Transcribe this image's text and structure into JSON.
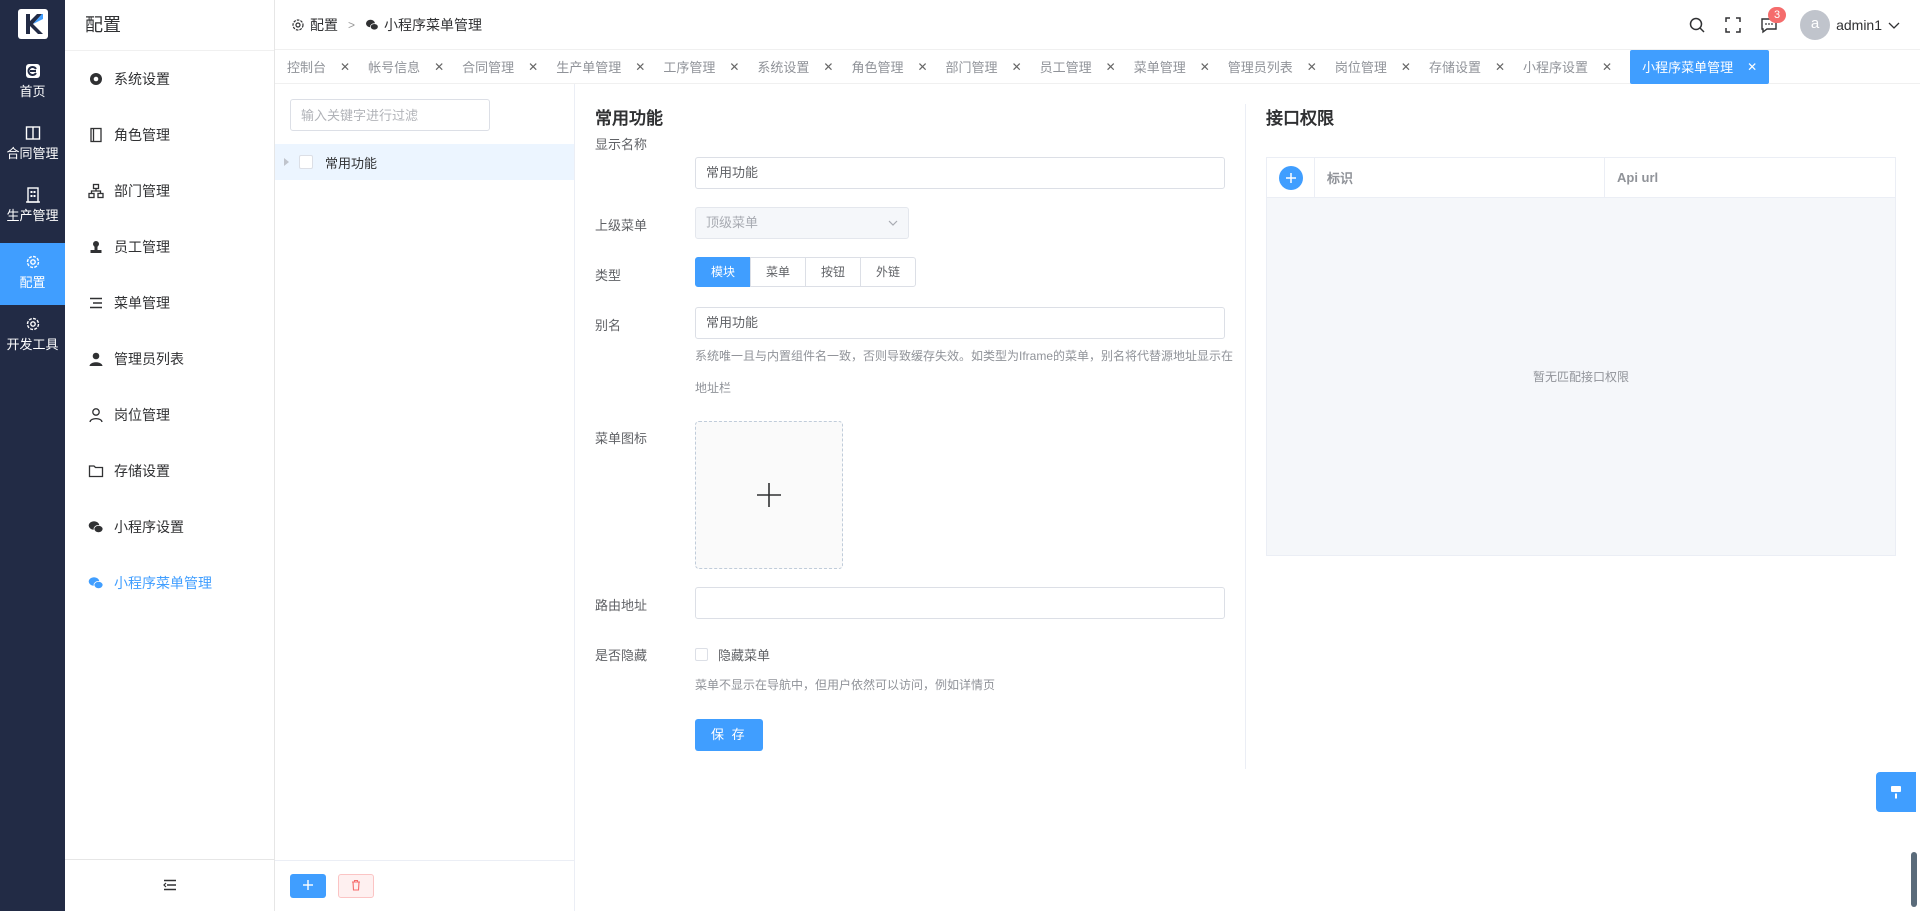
{
  "rail": {
    "items": [
      {
        "label": "首页",
        "icon": "home-icon"
      },
      {
        "label": "合同管理",
        "icon": "book-icon"
      },
      {
        "label": "生产管理",
        "icon": "building-icon"
      },
      {
        "label": "配置",
        "icon": "gear-icon"
      },
      {
        "label": "开发工具",
        "icon": "gear-icon"
      }
    ]
  },
  "sidebar": {
    "title": "配置",
    "items": [
      {
        "label": "系统设置"
      },
      {
        "label": "角色管理"
      },
      {
        "label": "部门管理"
      },
      {
        "label": "员工管理"
      },
      {
        "label": "菜单管理"
      },
      {
        "label": "管理员列表"
      },
      {
        "label": "岗位管理"
      },
      {
        "label": "存储设置"
      },
      {
        "label": "小程序设置"
      },
      {
        "label": "小程序菜单管理"
      }
    ]
  },
  "header": {
    "crumb1": "配置",
    "crumb2": "小程序菜单管理",
    "badge": "3",
    "avatar_letter": "a",
    "username": "admin1"
  },
  "tabs": [
    "控制台",
    "帐号信息",
    "合同管理",
    "生产单管理",
    "工序管理",
    "系统设置",
    "角色管理",
    "部门管理",
    "员工管理",
    "菜单管理",
    "管理员列表",
    "岗位管理",
    "存储设置",
    "小程序设置",
    "小程序菜单管理"
  ],
  "tree": {
    "filter_placeholder": "输入关键字进行过滤",
    "node": "常用功能"
  },
  "form": {
    "title": "常用功能",
    "display_name_label": "显示名称",
    "display_name_value": "常用功能",
    "parent_label": "上级菜单",
    "parent_value": "顶级菜单",
    "type_label": "类型",
    "type_options": [
      "模块",
      "菜单",
      "按钮",
      "外链"
    ],
    "alias_label": "别名",
    "alias_value": "常用功能",
    "alias_hint": "系统唯一且与内置组件名一致，否则导致缓存失效。如类型为Iframe的菜单，别名将代替源地址显示在地址栏",
    "icon_label": "菜单图标",
    "route_label": "路由地址",
    "route_value": "",
    "hidden_label": "是否隐藏",
    "hidden_check_label": "隐藏菜单",
    "hidden_hint": "菜单不显示在导航中，但用户依然可以访问，例如详情页",
    "save_label": "保 存"
  },
  "api": {
    "title": "接口权限",
    "col_id": "标识",
    "col_url": "Api url",
    "empty": "暂无匹配接口权限"
  },
  "colors": {
    "primary": "#409eff",
    "rail_bg": "#222b45",
    "danger": "#f56c6c"
  }
}
